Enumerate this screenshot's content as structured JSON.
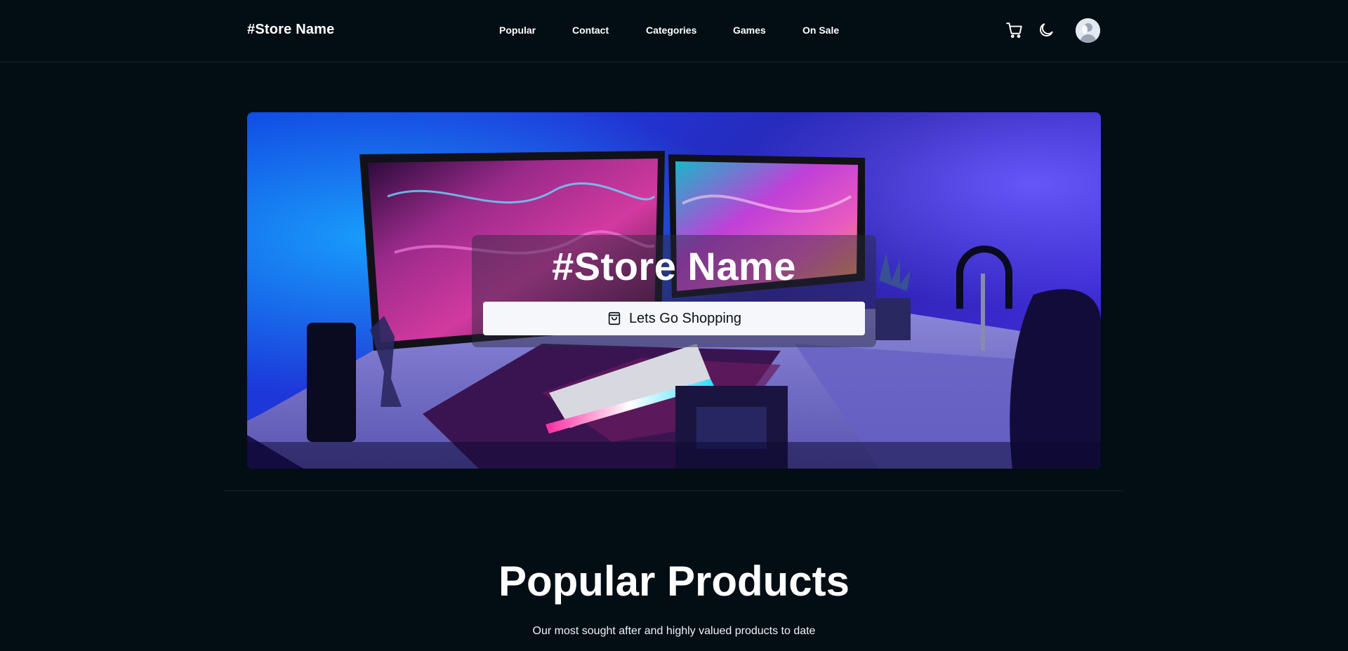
{
  "header": {
    "brand": "#Store Name",
    "nav": [
      "Popular",
      "Contact",
      "Categories",
      "Games",
      "On Sale"
    ],
    "icons": {
      "cart": "cart-icon",
      "theme": "moon-icon",
      "avatar": "avatar"
    }
  },
  "hero": {
    "title": "#Store Name",
    "button_label": "Lets Go Shopping",
    "button_icon": "shopping-bag-icon",
    "image_description_icon": "gaming-setup-photo"
  },
  "popular": {
    "title": "Popular Products",
    "subtitle": "Our most sought after and highly valued products to date"
  },
  "colors": {
    "background": "#020d14",
    "text": "#ffffff",
    "button_bg": "#f5f7fa",
    "button_text": "#0b1118",
    "divider": "#17232c"
  }
}
